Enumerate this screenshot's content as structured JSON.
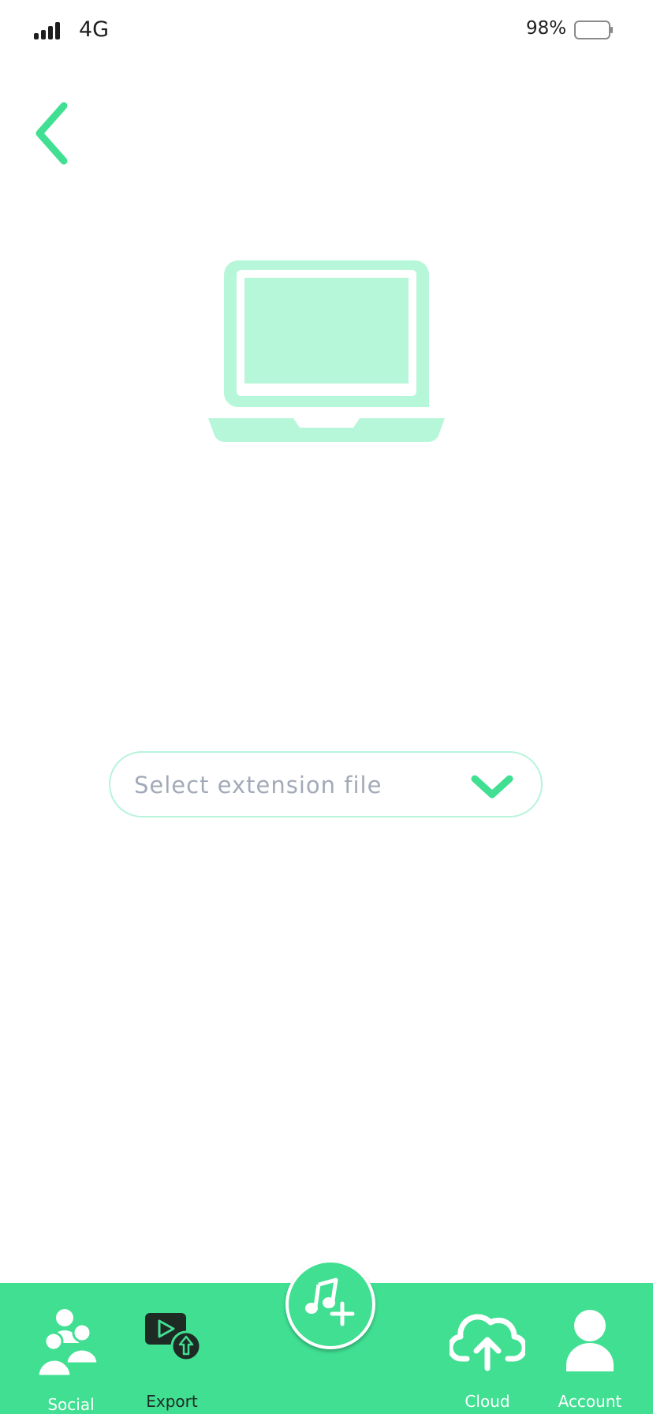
{
  "status_bar": {
    "network": "4G",
    "battery_percent": "98%"
  },
  "colors": {
    "accent": "#40df92",
    "illustration": "#b7f7d9",
    "select_border": "#b7f4da",
    "placeholder": "#a2aab8"
  },
  "icons": {
    "back": "chevron-left-icon",
    "illustration": "laptop-icon",
    "select": "chevron-down-icon",
    "social": "people-icon",
    "export": "video-export-icon",
    "add_music": "music-add-icon",
    "cloud": "cloud-upload-icon",
    "account": "person-icon"
  },
  "select": {
    "placeholder": "Select extension file"
  },
  "nav": {
    "social": "Social",
    "export": "Export",
    "cloud": "Cloud",
    "account": "Account"
  }
}
